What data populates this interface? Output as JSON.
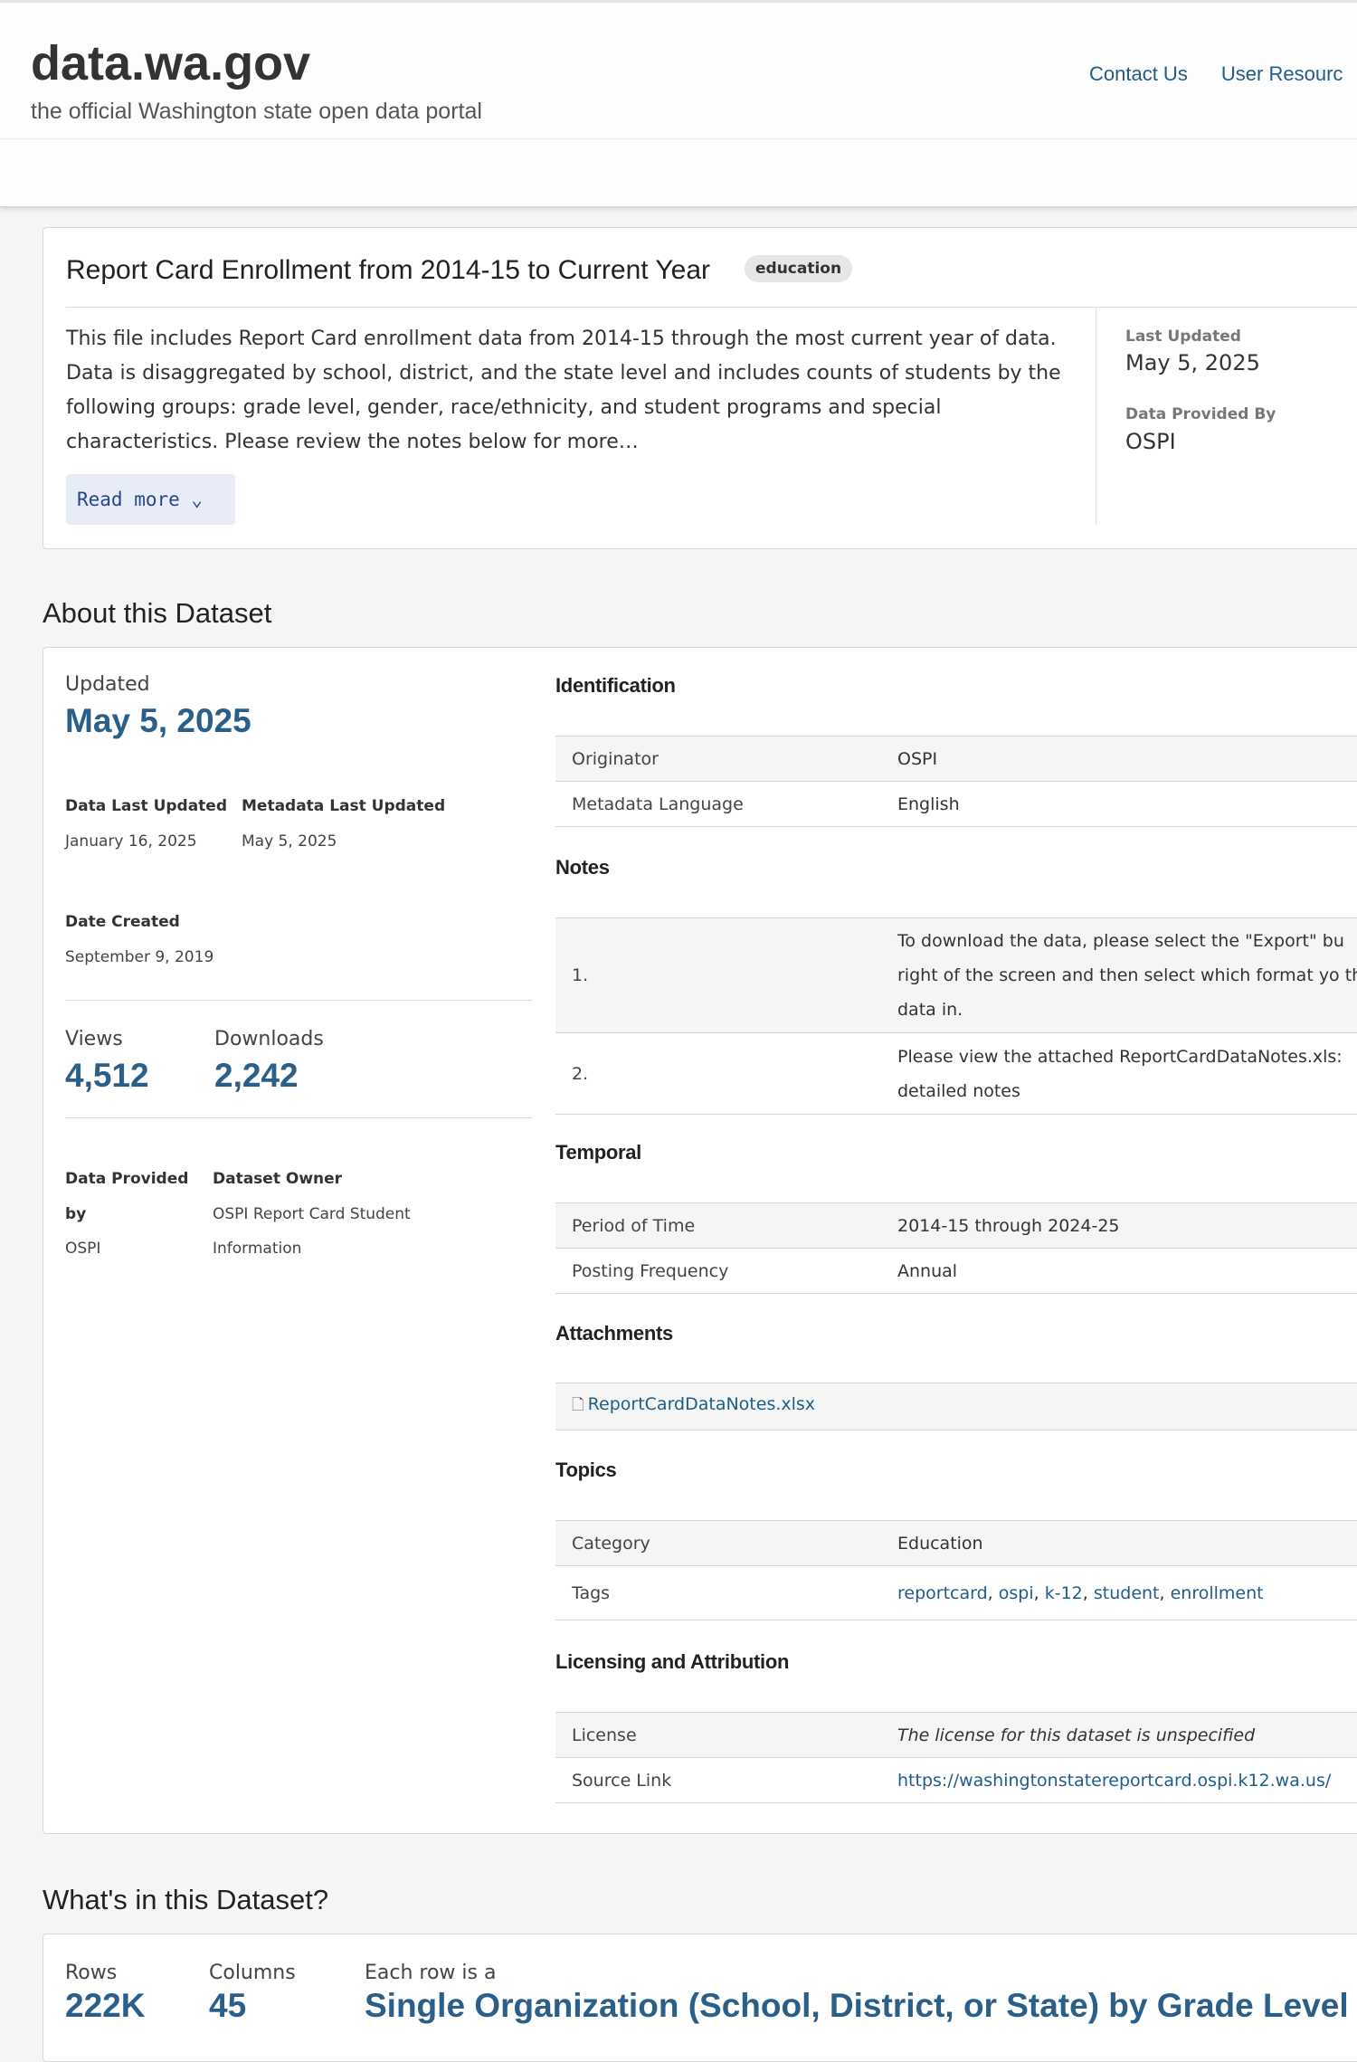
{
  "site": {
    "title": "data.wa.gov",
    "subtitle": "the official Washington state open data portal",
    "nav": [
      "Contact Us",
      "User Resourc"
    ]
  },
  "summary": {
    "title": "Report Card Enrollment from 2014-15 to Current Year",
    "tag": "education",
    "description": "This file includes Report Card enrollment data from 2014-15 through the most current year of data. Data is disaggregated by school, district, and the state level and includes counts of students by the following groups: grade level, gender, race/ethnicity, and student programs and special characteristics. Please review the notes below for more…",
    "read_more": "Read more ⌄",
    "last_updated_label": "Last Updated",
    "last_updated_value": "May 5, 2025",
    "provided_by_label": "Data Provided By",
    "provided_by_value": "OSPI"
  },
  "about": {
    "heading": "About this Dataset",
    "updated_label": "Updated",
    "updated_value": "May 5, 2025",
    "data_last_updated_label": "Data Last Updated",
    "data_last_updated_value": "January 16, 2025",
    "metadata_last_updated_label": "Metadata Last Updated",
    "metadata_last_updated_value": "May 5, 2025",
    "date_created_label": "Date Created",
    "date_created_value": "September 9, 2019",
    "views_label": "Views",
    "views_value": "4,512",
    "downloads_label": "Downloads",
    "downloads_value": "2,242",
    "provided_label_1": "Data Provided",
    "provided_label_2": "by",
    "provided_value": "OSPI",
    "owner_label": "Dataset Owner",
    "owner_value_1": "OSPI Report Card Student",
    "owner_value_2": "Information",
    "identification": {
      "heading": "Identification",
      "originator_label": "Originator",
      "originator_value": "OSPI",
      "language_label": "Metadata Language",
      "language_value": "English"
    },
    "notes": {
      "heading": "Notes",
      "n1_label": "1.",
      "n1_value": "To download the data, please select the \"Export\" bu right of the screen and then select which format yo the data in.",
      "n2_label": "2.",
      "n2_value": "Please view the attached ReportCardDataNotes.xls: detailed notes"
    },
    "temporal": {
      "heading": "Temporal",
      "period_label": "Period of Time",
      "period_value": "2014-15 through 2024-25",
      "frequency_label": "Posting Frequency",
      "frequency_value": "Annual"
    },
    "attachments": {
      "heading": "Attachments",
      "file": "ReportCardDataNotes.xlsx"
    },
    "topics": {
      "heading": "Topics",
      "category_label": "Category",
      "category_value": "Education",
      "tags_label": "Tags",
      "tags": [
        "reportcard",
        "ospi",
        "k-12",
        "student",
        "enrollment"
      ]
    },
    "licensing": {
      "heading": "Licensing and Attribution",
      "license_label": "License",
      "license_value": "The license for this dataset is unspecified",
      "source_label": "Source Link",
      "source_value": "https://washingtonstatereportcard.ospi.k12.wa.us/"
    }
  },
  "whats": {
    "heading": "What's in this Dataset?",
    "rows_label": "Rows",
    "rows_value": "222K",
    "columns_label": "Columns",
    "columns_value": "45",
    "row_label": "Each row is a",
    "row_value": "Single Organization (School, District, or State) by Grade Level"
  }
}
